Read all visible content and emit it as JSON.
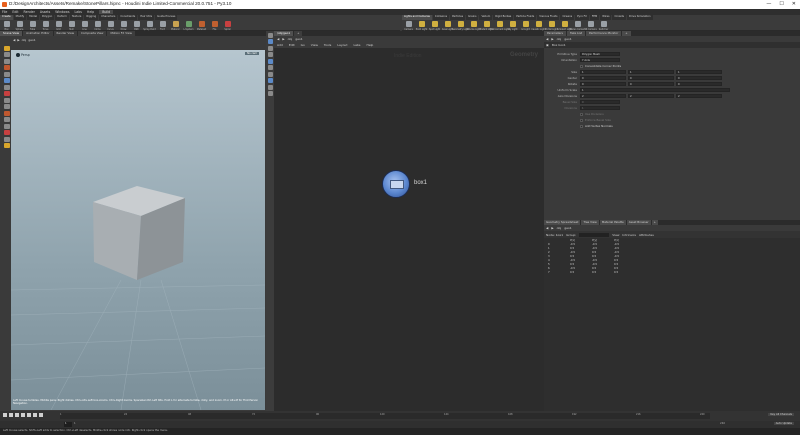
{
  "window": {
    "title": "D:/DesignArchitects/Assets/Remake/StonePillars.hipnc - Houdini Indie Limited-Commercial 20.0.751 - Py3.10",
    "buttons": [
      "—",
      "☐",
      "✕"
    ]
  },
  "menu": {
    "items": [
      "File",
      "Edit",
      "Render",
      "Assets",
      "Windows",
      "Labs",
      "Help"
    ],
    "desktop": "Build"
  },
  "shelf_left": {
    "tabs": [
      "Create",
      "Modify",
      "Model",
      "Polygon",
      "Deform",
      "Texture",
      "Rigging",
      "Characters",
      "Constraints",
      "Hair Utils",
      "Guide Process"
    ],
    "tools": [
      {
        "label": "Box",
        "icon": "box-icon",
        "color": "#9aa0a6"
      },
      {
        "label": "Sphere",
        "icon": "sphere-icon",
        "color": "#9aa0a6"
      },
      {
        "label": "Tube",
        "icon": "tube-icon",
        "color": "#9aa0a6"
      },
      {
        "label": "Torus",
        "icon": "torus-icon",
        "color": "#9aa0a6"
      },
      {
        "label": "Grid",
        "icon": "grid-icon",
        "color": "#9aa0a6"
      },
      {
        "label": "Null",
        "icon": "null-icon",
        "color": "#9aa0a6"
      },
      {
        "label": "Line",
        "icon": "line-icon",
        "color": "#9aa0a6"
      },
      {
        "label": "Circle",
        "icon": "circle-icon",
        "color": "#9aa0a6"
      },
      {
        "label": "Curve",
        "icon": "curve-icon",
        "color": "#9aa0a6"
      },
      {
        "label": "Draw",
        "icon": "draw-icon",
        "color": "#9aa0a6"
      },
      {
        "label": "Path",
        "icon": "path-icon",
        "color": "#9aa0a6"
      },
      {
        "label": "Spray Paint",
        "icon": "spray-icon",
        "color": "#9aa0a6"
      },
      {
        "label": "Font",
        "icon": "font-icon",
        "color": "#9aa0a6"
      },
      {
        "label": "Platonic",
        "icon": "platonic-icon",
        "color": "#c8a250"
      },
      {
        "label": "L-System",
        "icon": "lsystem-icon",
        "color": "#6a9e6a"
      },
      {
        "label": "Metaball",
        "icon": "metaball-icon",
        "color": "#c06030"
      },
      {
        "label": "File",
        "icon": "file-icon",
        "color": "#c06030"
      },
      {
        "label": "Spiral",
        "icon": "spiral-icon",
        "color": "#c84040"
      }
    ]
  },
  "shelf_right": {
    "tabs": [
      "Lights and Cameras",
      "Collisions",
      "Particles",
      "Grains",
      "Vellum",
      "Rigid Bodies",
      "Particle Fluids",
      "Viscous Fluids",
      "Oceans",
      "Pyro FX",
      "FEM",
      "Wires",
      "Crowds",
      "Drive Simulation"
    ],
    "tools": [
      {
        "label": "Camera",
        "icon": "camera-icon",
        "color": "#9aa0a6"
      },
      {
        "label": "Point Light",
        "icon": "point-light-icon",
        "color": "#d0b040"
      },
      {
        "label": "Spot Light",
        "icon": "spot-light-icon",
        "color": "#d0b040"
      },
      {
        "label": "Area Light",
        "icon": "area-light-icon",
        "color": "#d0b040"
      },
      {
        "label": "Geometry Light",
        "icon": "geo-light-icon",
        "color": "#d0b040"
      },
      {
        "label": "Volume Light",
        "icon": "volume-light-icon",
        "color": "#d0b040"
      },
      {
        "label": "Distant Light",
        "icon": "distant-light-icon",
        "color": "#d0b040"
      },
      {
        "label": "Environment Light",
        "icon": "env-light-icon",
        "color": "#d0b040"
      },
      {
        "label": "Sky Light",
        "icon": "sky-light-icon",
        "color": "#d0b040"
      },
      {
        "label": "GI Light",
        "icon": "gi-light-icon",
        "color": "#d0b040"
      },
      {
        "label": "Caustic Light",
        "icon": "caustic-light-icon",
        "color": "#d0b040"
      },
      {
        "label": "Portal Light",
        "icon": "portal-light-icon",
        "color": "#d0b040"
      },
      {
        "label": "Ambient Light",
        "icon": "ambient-light-icon",
        "color": "#d0b040"
      },
      {
        "label": "Stereo Camera",
        "icon": "stereo-camera-icon",
        "color": "#9aa0a6"
      },
      {
        "label": "VR Camera",
        "icon": "vr-camera-icon",
        "color": "#9aa0a6"
      },
      {
        "label": "Switcher",
        "icon": "switcher-icon",
        "color": "#9aa0a6"
      }
    ]
  },
  "viewport": {
    "tabs": [
      "Scene View",
      "Animation Editor",
      "Render View",
      "Composite View",
      "Motion FX View"
    ],
    "path": "obj",
    "path2": "geo1",
    "view_label": "Persp",
    "camera_button": "No cam",
    "hint": "Left mouse tumbles. Middle pans. Right dollies. Ctrl+Alt+Left box-zooms. Ctrl+Right zooms. Spacebar-Ctrl-Left tilts. Hold L for alternate tumble, dolly, and zoom. M or Alt+M for First Person Navigation."
  },
  "network": {
    "tabs": [
      "/obj/geo1",
      "+"
    ],
    "path": "obj",
    "path2": "geo1",
    "menu": [
      "Add",
      "Edit",
      "Go",
      "View",
      "Tools",
      "Layout",
      "Labs",
      "Help"
    ],
    "context_left": "Indie Edition",
    "context_right": "Geometry",
    "node_label": "box1"
  },
  "parameters": {
    "tabs": [
      "Parameters",
      "Take List",
      "Performance Monitor",
      "+"
    ],
    "path": "obj",
    "path2": "geo1",
    "node_title": "Box  box1",
    "rows": [
      {
        "label": "Primitive Type",
        "values": [
          "Polygon Mesh"
        ]
      },
      {
        "label": "Orientation",
        "values": [
          "Y Axis"
        ]
      },
      {
        "label": "",
        "values": [
          "Consolidate Corner Points"
        ],
        "checkbox": true
      },
      {
        "label": "Size",
        "values": [
          "1",
          "1",
          "1"
        ]
      },
      {
        "label": "Center",
        "values": [
          "0",
          "0",
          "0"
        ]
      },
      {
        "label": "Rotate",
        "values": [
          "0",
          "0",
          "0"
        ]
      },
      {
        "label": "Uniform Scale",
        "values": [
          "1"
        ]
      },
      {
        "label": "Axis Divisions",
        "values": [
          "2",
          "2",
          "2"
        ]
      },
      {
        "label": "Bevel Size",
        "values": [
          "0"
        ],
        "dim": true
      },
      {
        "label": "Divisions",
        "values": [
          "1"
        ],
        "dim": true
      },
      {
        "label": "",
        "values": [
          "Use Divisions"
        ],
        "checkbox": true,
        "dim": true
      },
      {
        "label": "",
        "values": [
          "Enforce Bevel Size"
        ],
        "checkbox": true,
        "dim": true
      },
      {
        "label": "",
        "values": [
          "Add Vertex Normals"
        ],
        "checkbox": true
      }
    ]
  },
  "spreadsheet": {
    "tabs": [
      "Geometry Spreadsheet",
      "Tree View",
      "Material Palette",
      "Asset Browser",
      "+"
    ],
    "path": "obj",
    "path2": "geo1",
    "node_label": "Node: box1",
    "group_label": "Group:",
    "view_label": "View",
    "intrinsics_label": "Intrinsics",
    "attributes_label": "Attributes",
    "columns": [
      "",
      "P[x]",
      "P[y]",
      "P[z]"
    ],
    "rows": [
      [
        "0",
        "-0.5",
        "-0.5",
        "-0.5"
      ],
      [
        "1",
        "0.5",
        "-0.5",
        "-0.5"
      ],
      [
        "2",
        "-0.5",
        "0.5",
        "-0.5"
      ],
      [
        "3",
        "0.5",
        "0.5",
        "-0.5"
      ],
      [
        "4",
        "-0.5",
        "-0.5",
        "0.5"
      ],
      [
        "5",
        "0.5",
        "-0.5",
        "0.5"
      ],
      [
        "6",
        "-0.5",
        "0.5",
        "0.5"
      ],
      [
        "7",
        "0.5",
        "0.5",
        "0.5"
      ]
    ]
  },
  "timeline": {
    "ticks": [
      "1",
      "24",
      "48",
      "72",
      "96",
      "120",
      "144",
      "168",
      "192",
      "216",
      "240"
    ],
    "frame": "1",
    "start": "1",
    "end": "240",
    "keys_label": "0 keys, 0/0 channels",
    "key_all": "Key All Channels",
    "realtime": "Auto Update"
  },
  "status": {
    "text": "Left mouse selects. Shift+Left adds to selection. Ctrl+Left deselects. Middle-click shows node info. Right-click opens the menu."
  }
}
